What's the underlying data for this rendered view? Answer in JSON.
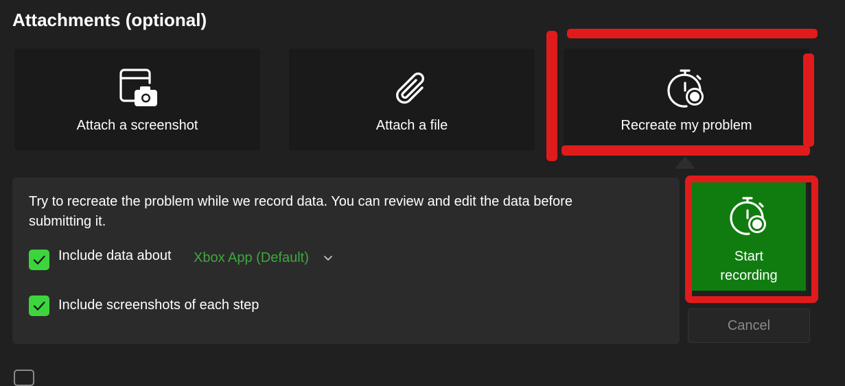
{
  "section": {
    "title": "Attachments (optional)"
  },
  "cards": [
    {
      "label": "Attach a screenshot",
      "icon": "screenshot-camera-icon"
    },
    {
      "label": "Attach a file",
      "icon": "paperclip-icon"
    },
    {
      "label": "Recreate my problem",
      "icon": "stopwatch-record-icon",
      "selected": true
    }
  ],
  "recreate_panel": {
    "description": "Try to recreate the problem while we record data. You can review and edit the data before submitting it.",
    "include_data": {
      "label": "Include data about",
      "checked": true,
      "selected_app": "Xbox App (Default)"
    },
    "include_screenshots": {
      "label": "Include screenshots of each step",
      "checked": true
    }
  },
  "actions": {
    "start_recording": "Start\nrecording",
    "cancel": "Cancel"
  },
  "colors": {
    "background": "#202020",
    "card": "#1a1a1a",
    "panel": "#2b2b2b",
    "accent_green": "#107c10",
    "checkbox_green": "#3dd53d",
    "link_green": "#3fa83f",
    "annotation_red": "#e01b1b"
  }
}
